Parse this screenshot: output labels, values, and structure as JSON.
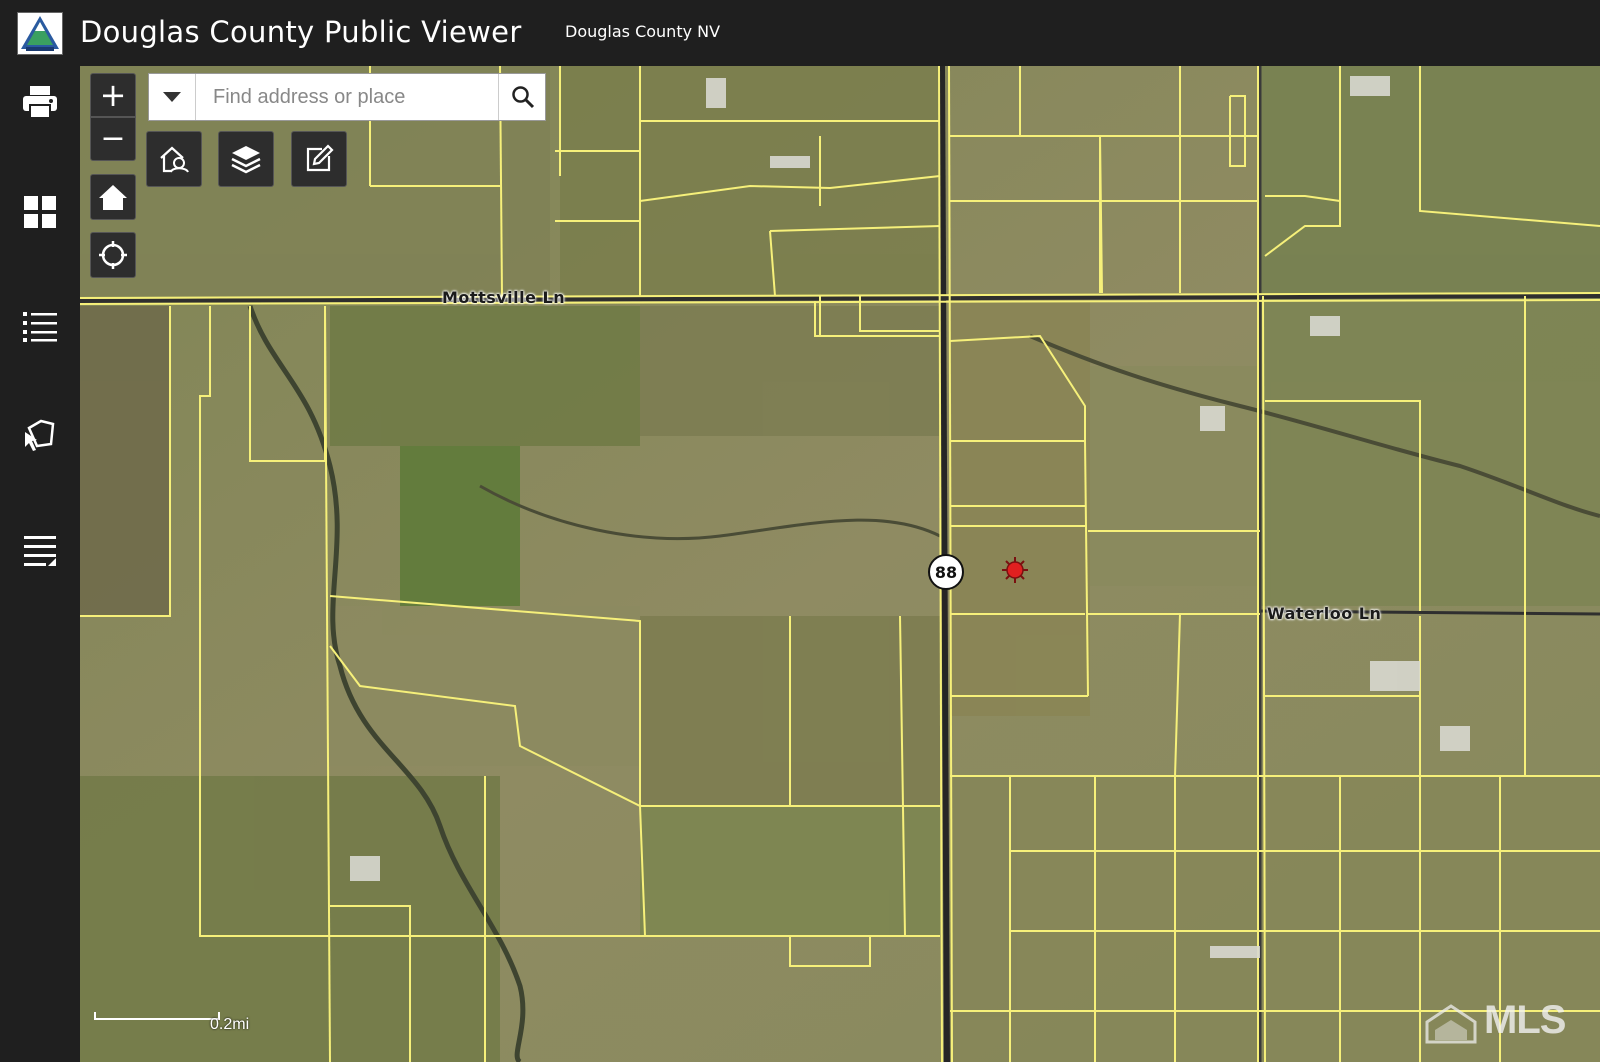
{
  "header": {
    "app_title": "Douglas County Public Viewer",
    "subtitle": "Douglas County NV",
    "logo_icon": "douglas-county-seal-logo"
  },
  "sidebar": {
    "items": [
      {
        "name": "print",
        "icon": "printer-icon"
      },
      {
        "name": "basemap-gallery",
        "icon": "grid-icon"
      },
      {
        "name": "legend",
        "icon": "list-icon"
      },
      {
        "name": "select",
        "icon": "select-cursor-icon"
      },
      {
        "name": "attribute-table",
        "icon": "table-list-icon"
      }
    ]
  },
  "map": {
    "search": {
      "placeholder": "Find address or place",
      "value": ""
    },
    "zoom": {
      "in_label": "+",
      "out_label": "−"
    },
    "tools": [
      {
        "name": "parcel-search",
        "icon": "house-search-icon"
      },
      {
        "name": "layers",
        "icon": "layers-icon"
      },
      {
        "name": "edit",
        "icon": "edit-pencil-icon"
      }
    ],
    "road_labels": [
      "Mottsville Ln",
      "Waterloo Ln"
    ],
    "highway_shield": "88",
    "scale_label": "0.2mi",
    "watermark": "MLS",
    "colors": {
      "parcel_lines": "#f6f07a",
      "header_bg": "#1f1f1f",
      "marker": "#e02020"
    }
  }
}
